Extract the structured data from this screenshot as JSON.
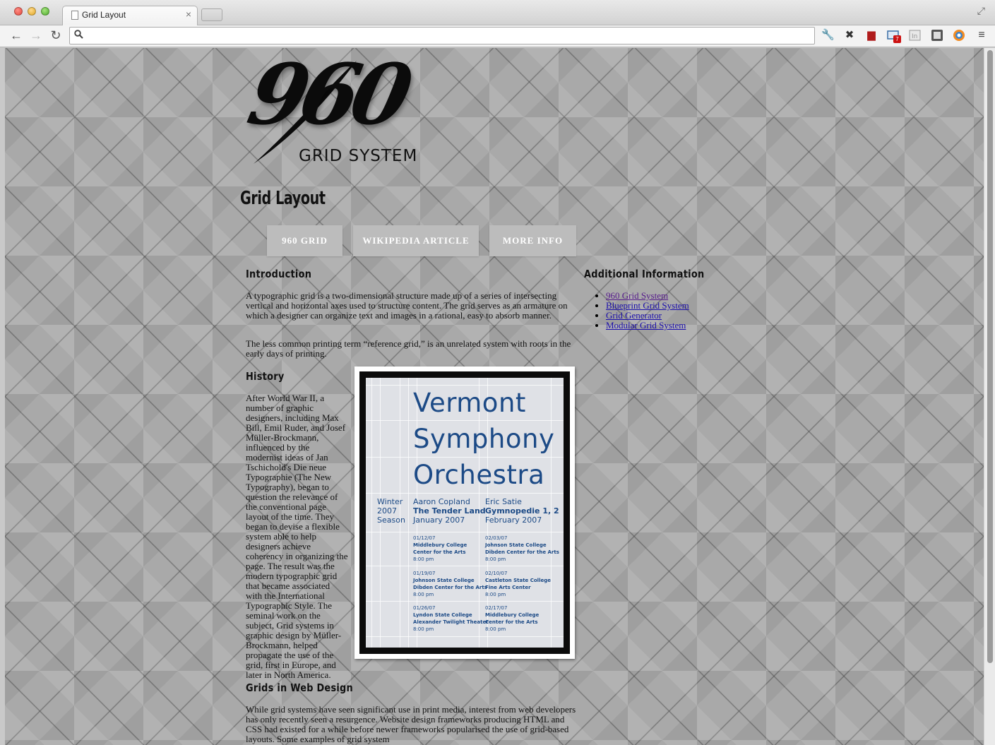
{
  "browser": {
    "tab_title": "Grid Layout",
    "tab_close": "×",
    "address": "",
    "ext_badge": "7"
  },
  "page": {
    "logo_number": "960",
    "logo_subtitle": "GRID SYSTEM",
    "heading": "Grid Layout",
    "nav": [
      "960 GRID",
      "WIKIPEDIA ARTICLE",
      "MORE INFO"
    ],
    "intro": {
      "heading": "Introduction",
      "p1": "A typographic grid is a two-dimensional structure made up of a series of intersecting vertical and horizontal axes used to structure content. The grid serves as an armature on which a designer can organize text and images in a rational, easy to absorb manner.",
      "p2": "The less common printing term “reference grid,” is an unrelated system with roots in the early days of printing."
    },
    "history": {
      "heading": "History",
      "text": "After World War II, a number of graphic designers, including Max Bill, Emil Ruder, and Josef Müller-Brockmann, influenced by the modernist ideas of Jan Tschichold's Die neue Typographie (The New Typography), began to question the relevance of the conventional page layout of the time. They began to devise a flexible system able to help designers achieve coherency in organizing the page. The result was the modern typographic grid that became associated with the International Typographic Style. The seminal work on the subject, Grid systems in graphic design by Müller-Brockmann, helped propagate the use of the grid, first in Europe, and later in North America."
    },
    "webdesign": {
      "heading": "Grids in Web Design",
      "text": "While grid systems have seen significant use in print media, interest from web developers has only recently seen a resurgence. Website design frameworks producing HTML and CSS had existed for a while before newer frameworks popularised the use of grid-based layouts. Some examples of grid system"
    },
    "additional": {
      "heading": "Additional Information",
      "links": [
        "960 Grid System",
        "Blueprint Grid System",
        "Grid Generator",
        "Modular Grid System"
      ]
    },
    "poster": {
      "title_lines": [
        "Vermont",
        "Symphony",
        "Orchestra"
      ],
      "season": [
        "Winter",
        "2007",
        "Season"
      ],
      "col1_composer": "Aaron Copland",
      "col1_work": "The Tender Land",
      "col1_date": "January 2007",
      "col2_composer": "Eric Satie",
      "col2_work": "Gymnopedie 1, 2",
      "col2_date": "February 2007",
      "events_col1": [
        {
          "date": "01/12/07",
          "venue1": "Middlebury College",
          "venue2": "Center for the Arts",
          "time": "8:00 pm"
        },
        {
          "date": "01/19/07",
          "venue1": "Johnson State College",
          "venue2": "Dibden Center for the Arts",
          "time": "8:00 pm"
        },
        {
          "date": "01/26/07",
          "venue1": "Lyndon State College",
          "venue2": "Alexander Twilight Theater",
          "time": "8:00 pm"
        }
      ],
      "events_col2": [
        {
          "date": "02/03/07",
          "venue1": "Johnson State College",
          "venue2": "Dibden Center for the Arts",
          "time": "8:00 pm"
        },
        {
          "date": "02/10/07",
          "venue1": "Castleton State College",
          "venue2": "Fine Arts Center",
          "time": "8:00 pm"
        },
        {
          "date": "02/17/07",
          "venue1": "Middlebury College",
          "venue2": "Center for the Arts",
          "time": "8:00 pm"
        }
      ]
    }
  }
}
